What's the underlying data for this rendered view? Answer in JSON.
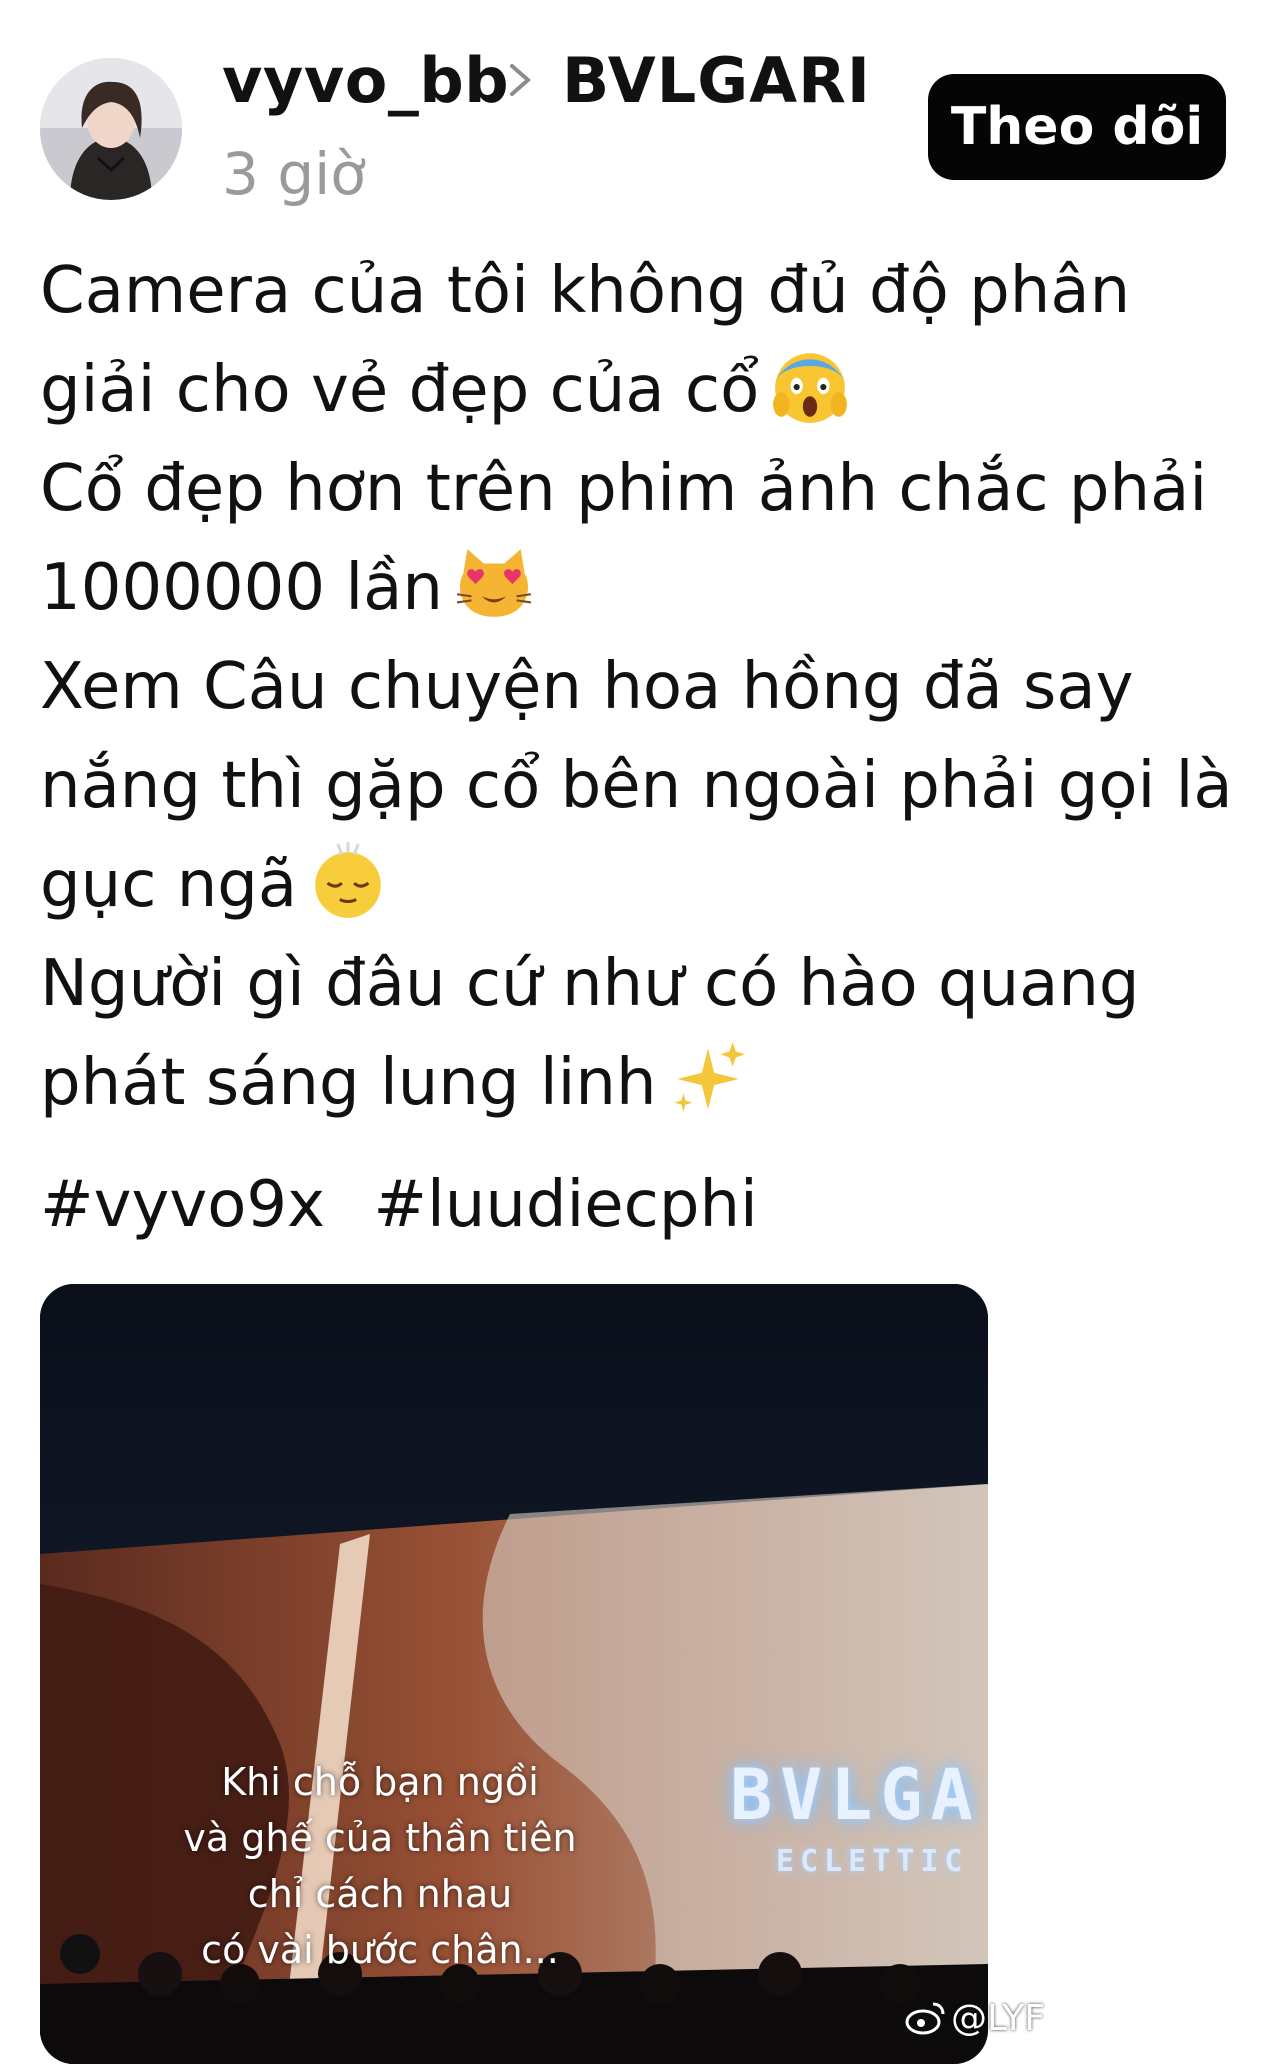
{
  "header": {
    "username": "vyvo_bb",
    "tagged_account": "BVLGARI",
    "timestamp": "3 giờ",
    "follow_label": "Theo dõi"
  },
  "post": {
    "lines": [
      "Camera của tôi không đủ độ phân",
      "giải cho vẻ đẹp của cổ",
      "Cổ đẹp hơn trên phim ảnh chắc phải",
      "1000000 lần",
      "Xem Câu chuyện hoa hồng đã say",
      "nắng thì gặp cổ bên ngoài phải gọi là",
      "gục ngã",
      "Người gì đâu cứ như có hào quang",
      "phát sáng lung linh"
    ],
    "hashtags": [
      "#vyvo9x",
      "#luudiecphi"
    ]
  },
  "media": {
    "caption_lines": [
      "Khi chỗ bạn ngồi",
      "và ghế của thần tiên",
      "chỉ cách nhau",
      "có vài bước chân..."
    ],
    "sign_text": "BVLGA",
    "sign_subtext": "ECLETTIC"
  },
  "watermark": {
    "icon": "weibo-icon",
    "text": "@LYF"
  },
  "emojis": [
    "face-screaming-icon",
    "heart-eyes-cat-icon",
    "relieved-face-icon",
    "sparkles-icon"
  ],
  "colors": {
    "follow_bg": "#050505",
    "timestamp": "#9a9a9a",
    "text": "#111111"
  }
}
